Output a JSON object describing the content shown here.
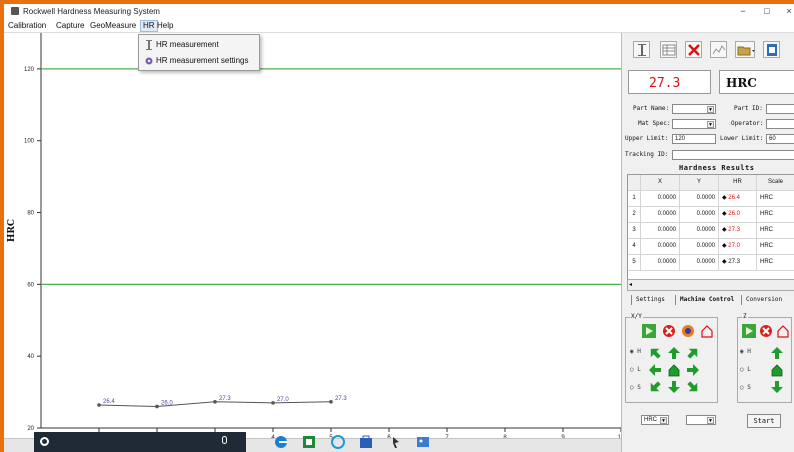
{
  "window": {
    "title": "Rockwell Hardness Measuring System",
    "minimize": "−",
    "maximize": "□",
    "close": "×"
  },
  "menubar": {
    "items": [
      {
        "label": "Calibration"
      },
      {
        "label": "Capture"
      },
      {
        "label": "GeoMeasure"
      },
      {
        "label": "HR"
      },
      {
        "label": "Help"
      }
    ],
    "active": "HR"
  },
  "hr_menu": {
    "items": [
      {
        "label": "HR measurement",
        "icon": "ruler-icon"
      },
      {
        "label": "HR measurement settings",
        "icon": "settings-icon"
      }
    ]
  },
  "toolbar": {
    "buttons": [
      "ruler-icon",
      "table-icon",
      "delete-icon",
      "chart-icon",
      "open-folder-icon",
      "report-icon"
    ]
  },
  "readout": {
    "value": "27.3",
    "scale": "HRC"
  },
  "form": {
    "part_name_label": "Part Name:",
    "part_id_label": "Part ID:",
    "mat_spec_label": "Mat Spec:",
    "operator_label": "Operator:",
    "upper_limit_label": "Upper Limit:",
    "upper_limit_value": "120",
    "lower_limit_label": "Lower Limit:",
    "lower_limit_value": "60",
    "tracking_id_label": "Tracking ID:"
  },
  "results": {
    "title": "Hardness Results",
    "columns": [
      "X",
      "Y",
      "HR",
      "Scale"
    ],
    "rows": [
      {
        "n": "1",
        "x": "0.0000",
        "y": "0.0000",
        "hr": "26.4",
        "scale": "HRC",
        "red": true
      },
      {
        "n": "2",
        "x": "0.0000",
        "y": "0.0000",
        "hr": "26.0",
        "scale": "HRC",
        "red": true
      },
      {
        "n": "3",
        "x": "0.0000",
        "y": "0.0000",
        "hr": "27.3",
        "scale": "HRC",
        "red": true
      },
      {
        "n": "4",
        "x": "0.0000",
        "y": "0.0000",
        "hr": "27.0",
        "scale": "HRC",
        "red": true
      },
      {
        "n": "5",
        "x": "0.0000",
        "y": "0.0000",
        "hr": "27.3",
        "scale": "HRC",
        "red": false
      }
    ],
    "marker": "◆"
  },
  "tabs": [
    {
      "label": "Settings"
    },
    {
      "label": "Machine Control"
    },
    {
      "label": "Conversion"
    }
  ],
  "machine_control": {
    "xy_group_label": "X/Y",
    "z_group_label": "Z",
    "radios_xy": [
      "H",
      "L",
      "S"
    ],
    "radios_z": [
      "H",
      "L",
      "S"
    ],
    "scale_select": "HRC",
    "start_label": "Start"
  },
  "colors": {
    "accent_green": "#1e9c2c",
    "limit_line": "#4caf50",
    "red_value": "#d11111",
    "data_line": "#555555",
    "taskbar": "#1f2a36",
    "desktop_orange": "#e9700f"
  },
  "chart_data": {
    "type": "line",
    "ylabel": "HRC",
    "ylim": [
      20,
      130
    ],
    "yticks": [
      20,
      40,
      60,
      80,
      100,
      120
    ],
    "xlim": [
      0,
      10
    ],
    "xticks": [
      1,
      2,
      3,
      4,
      5,
      6,
      7,
      8,
      9,
      10
    ],
    "limits": {
      "upper": 120,
      "lower": 60
    },
    "series": [
      {
        "x": [
          1,
          2,
          3,
          4,
          5
        ],
        "values": [
          26.4,
          26.0,
          27.3,
          27.0,
          27.3
        ],
        "labels": [
          "26.4",
          "26.0",
          "27.3",
          "27.0",
          "27.3"
        ]
      }
    ]
  }
}
